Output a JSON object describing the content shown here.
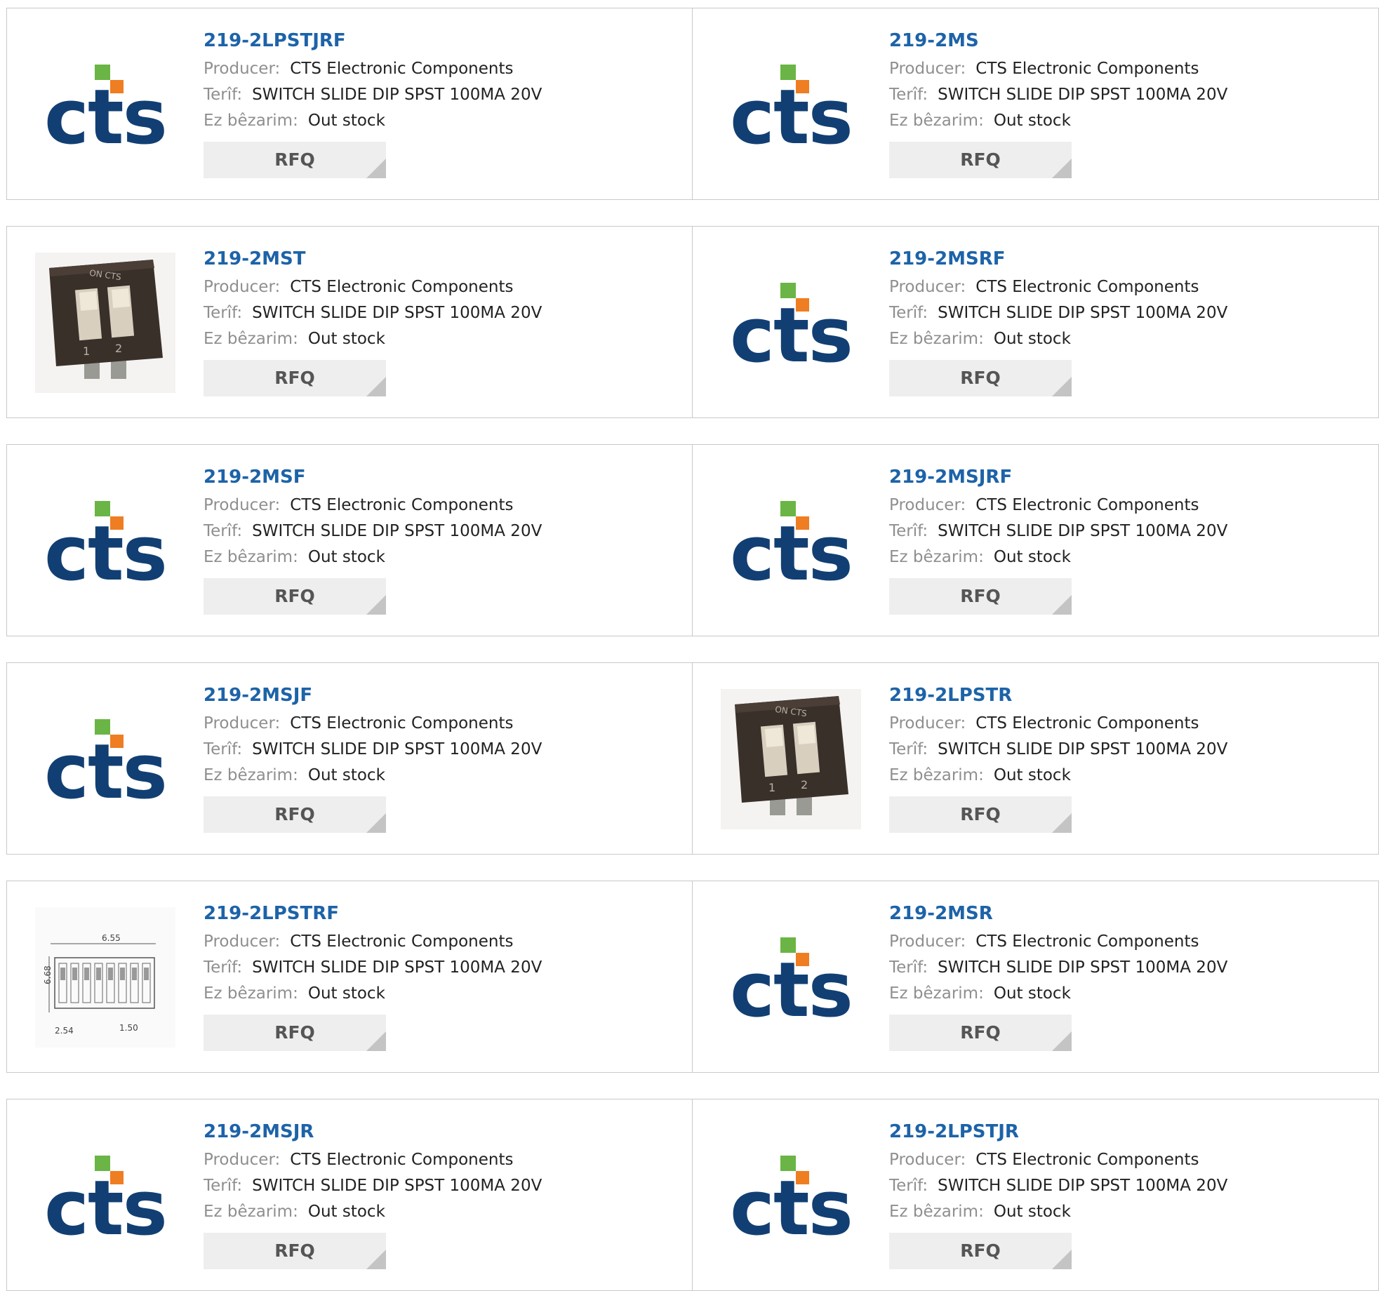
{
  "labels": {
    "producer": "Producer:",
    "description": "Terîf:",
    "stock": "Ez bêzarim:",
    "rfq": "RFQ"
  },
  "products": [
    {
      "part": "219-2LPSTJRF",
      "producer": "CTS Electronic Components",
      "description": "SWITCH SLIDE DIP SPST 100MA 20V",
      "stock": "Out stock",
      "image": "cts-logo"
    },
    {
      "part": "219-2MS",
      "producer": "CTS Electronic Components",
      "description": "SWITCH SLIDE DIP SPST 100MA 20V",
      "stock": "Out stock",
      "image": "cts-logo"
    },
    {
      "part": "219-2MST",
      "producer": "CTS Electronic Components",
      "description": "SWITCH SLIDE DIP SPST 100MA 20V",
      "stock": "Out stock",
      "image": "dip-switch-photo"
    },
    {
      "part": "219-2MSRF",
      "producer": "CTS Electronic Components",
      "description": "SWITCH SLIDE DIP SPST 100MA 20V",
      "stock": "Out stock",
      "image": "cts-logo"
    },
    {
      "part": "219-2MSF",
      "producer": "CTS Electronic Components",
      "description": "SWITCH SLIDE DIP SPST 100MA 20V",
      "stock": "Out stock",
      "image": "cts-logo"
    },
    {
      "part": "219-2MSJRF",
      "producer": "CTS Electronic Components",
      "description": "SWITCH SLIDE DIP SPST 100MA 20V",
      "stock": "Out stock",
      "image": "cts-logo"
    },
    {
      "part": "219-2MSJF",
      "producer": "CTS Electronic Components",
      "description": "SWITCH SLIDE DIP SPST 100MA 20V",
      "stock": "Out stock",
      "image": "cts-logo"
    },
    {
      "part": "219-2LPSTR",
      "producer": "CTS Electronic Components",
      "description": "SWITCH SLIDE DIP SPST 100MA 20V",
      "stock": "Out stock",
      "image": "dip-switch-photo"
    },
    {
      "part": "219-2LPSTRF",
      "producer": "CTS Electronic Components",
      "description": "SWITCH SLIDE DIP SPST 100MA 20V",
      "stock": "Out stock",
      "image": "dip-switch-drawing"
    },
    {
      "part": "219-2MSR",
      "producer": "CTS Electronic Components",
      "description": "SWITCH SLIDE DIP SPST 100MA 20V",
      "stock": "Out stock",
      "image": "cts-logo"
    },
    {
      "part": "219-2MSJR",
      "producer": "CTS Electronic Components",
      "description": "SWITCH SLIDE DIP SPST 100MA 20V",
      "stock": "Out stock",
      "image": "cts-logo"
    },
    {
      "part": "219-2LPSTJR",
      "producer": "CTS Electronic Components",
      "description": "SWITCH SLIDE DIP SPST 100MA 20V",
      "stock": "Out stock",
      "image": "cts-logo"
    }
  ],
  "images": {
    "cts-logo": {
      "text": "cts"
    },
    "dip-switch-photo": {
      "on_text": "ON CTS",
      "pos1": "1",
      "pos2": "2"
    },
    "dip-switch-drawing": {
      "width_dim": "6.55",
      "height_dim": "6.68",
      "pitch_dim": "2.54",
      "gap_dim": "1.50"
    }
  },
  "colors": {
    "link": "#1d63a8",
    "cts_blue": "#123f73",
    "cts_green": "#6ab545",
    "cts_orange": "#ef7d22",
    "button_bg": "#eeeeee"
  }
}
